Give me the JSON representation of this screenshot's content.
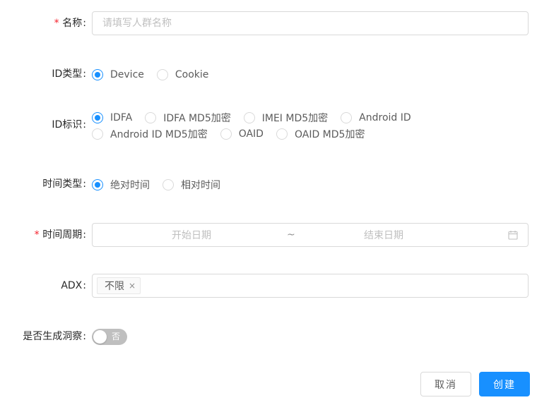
{
  "form": {
    "name": {
      "label": "名称",
      "required": true,
      "placeholder": "请填写人群名称",
      "value": ""
    },
    "id_type": {
      "label": "ID类型",
      "options": [
        {
          "label": "Device",
          "checked": true
        },
        {
          "label": "Cookie",
          "checked": false
        }
      ]
    },
    "id_mark": {
      "label": "ID标识",
      "options": [
        {
          "label": "IDFA",
          "checked": true
        },
        {
          "label": "IDFA MD5加密",
          "checked": false
        },
        {
          "label": "IMEI MD5加密",
          "checked": false
        },
        {
          "label": "Android ID",
          "checked": false
        },
        {
          "label": "Android ID MD5加密",
          "checked": false
        },
        {
          "label": "OAID",
          "checked": false
        },
        {
          "label": "OAID MD5加密",
          "checked": false
        }
      ]
    },
    "time_type": {
      "label": "时间类型",
      "options": [
        {
          "label": "绝对时间",
          "checked": true
        },
        {
          "label": "相对时间",
          "checked": false
        }
      ]
    },
    "time_period": {
      "label": "时间周期",
      "required": true,
      "start_placeholder": "开始日期",
      "separator": "~",
      "end_placeholder": "结束日期"
    },
    "adx": {
      "label": "ADX",
      "tags": [
        "不限"
      ],
      "tag_close": "×"
    },
    "insight": {
      "label": "是否生成洞察",
      "switch_text": "否",
      "on": false
    },
    "colon": ":",
    "required_mark": "*"
  },
  "actions": {
    "cancel_label": "取消",
    "create_label": "创建"
  },
  "colors": {
    "primary": "#1890ff",
    "required": "#f5222d",
    "border": "#d9d9d9"
  }
}
